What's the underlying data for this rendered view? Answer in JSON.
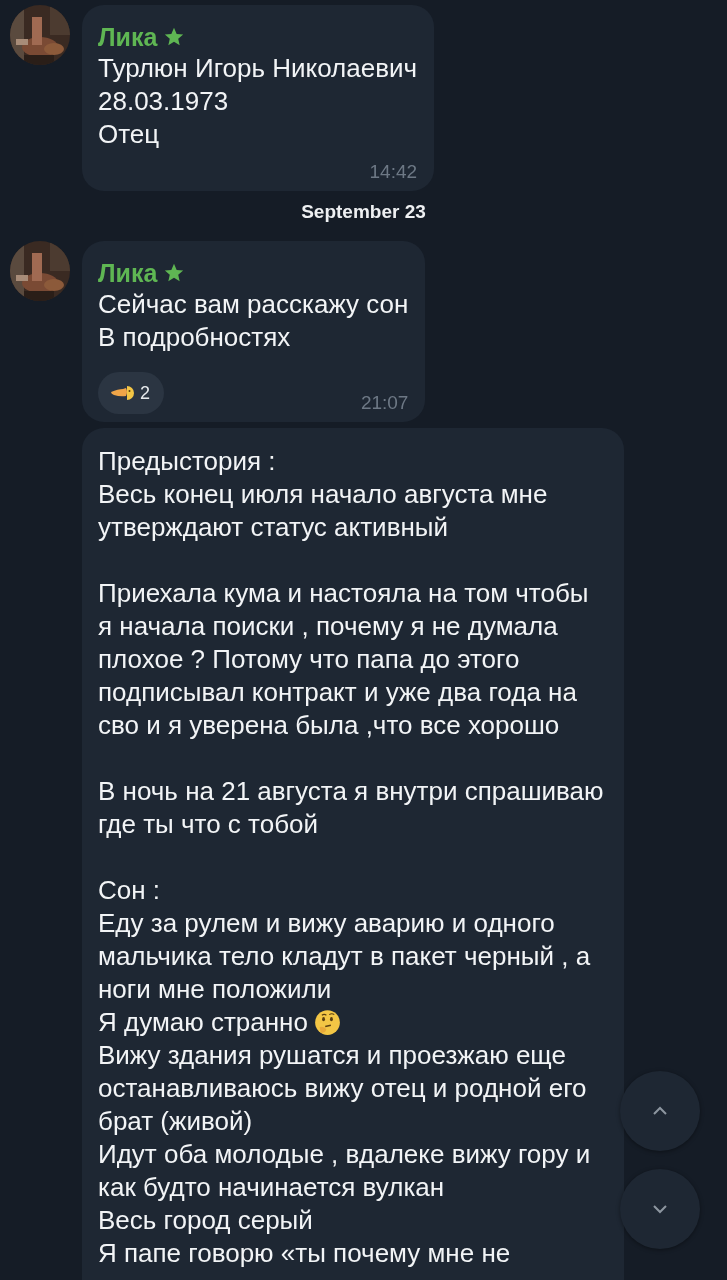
{
  "messages": [
    {
      "sender": "Лика",
      "sender_badge": true,
      "avatar": {
        "kind": "picture"
      },
      "paragraphs": [
        [
          {
            "text": "Турлюн Игорь Николаевич"
          },
          {
            "text": "28.03.1973"
          },
          {
            "text": "Отец"
          }
        ]
      ],
      "time": "14:42"
    },
    {
      "kind": "date",
      "label": "September 23"
    },
    {
      "sender": "Лика",
      "sender_badge": true,
      "avatar": {
        "kind": "picture"
      },
      "paragraphs": [
        [
          {
            "text": "Сейчас вам расскажу сон"
          },
          {
            "text": "В подробностях"
          }
        ]
      ],
      "reaction": {
        "count": "2"
      },
      "time": "21:07"
    },
    {
      "paragraphs": [
        [
          {
            "text": "Предыстория :"
          },
          {
            "text": "Весь конец июля начало августа мне"
          },
          {
            "text": "утверждают статус активный"
          }
        ],
        [
          {
            "text": "Приехала кума и настояла на том чтобы"
          },
          {
            "text": "я начала поиски , почему я не думала"
          },
          {
            "text": "плохое ? Потому что папа до этого"
          },
          {
            "text": "подписывал контракт и уже два года на"
          },
          {
            "text": "сво и я уверена была ,что все хорошо"
          }
        ],
        [
          {
            "text": "В ночь на 21 августа я внутри спрашиваю"
          },
          {
            "text": "где ты что с тобой"
          }
        ],
        [
          {
            "text": "Сон :"
          },
          {
            "text": "Еду за рулем и вижу аварию и одного"
          },
          {
            "text": "мальчика тело кладут в пакет черный , а"
          },
          {
            "text": "ноги мне положили"
          },
          {
            "text": "Я думаю странно",
            "thinking_emoji": true
          },
          {
            "text": "Вижу здания рушатся и проезжаю еще"
          },
          {
            "text": "останавливаюсь вижу отец и родной его"
          },
          {
            "text": "брат (живой)"
          },
          {
            "text": "Идут оба молодые , вдалеке вижу гору и"
          },
          {
            "text": "как будто начинается вулкан"
          },
          {
            "text": "Весь город серый"
          },
          {
            "text": "Я папе говорю «ты почему мне не"
          }
        ]
      ]
    }
  ]
}
